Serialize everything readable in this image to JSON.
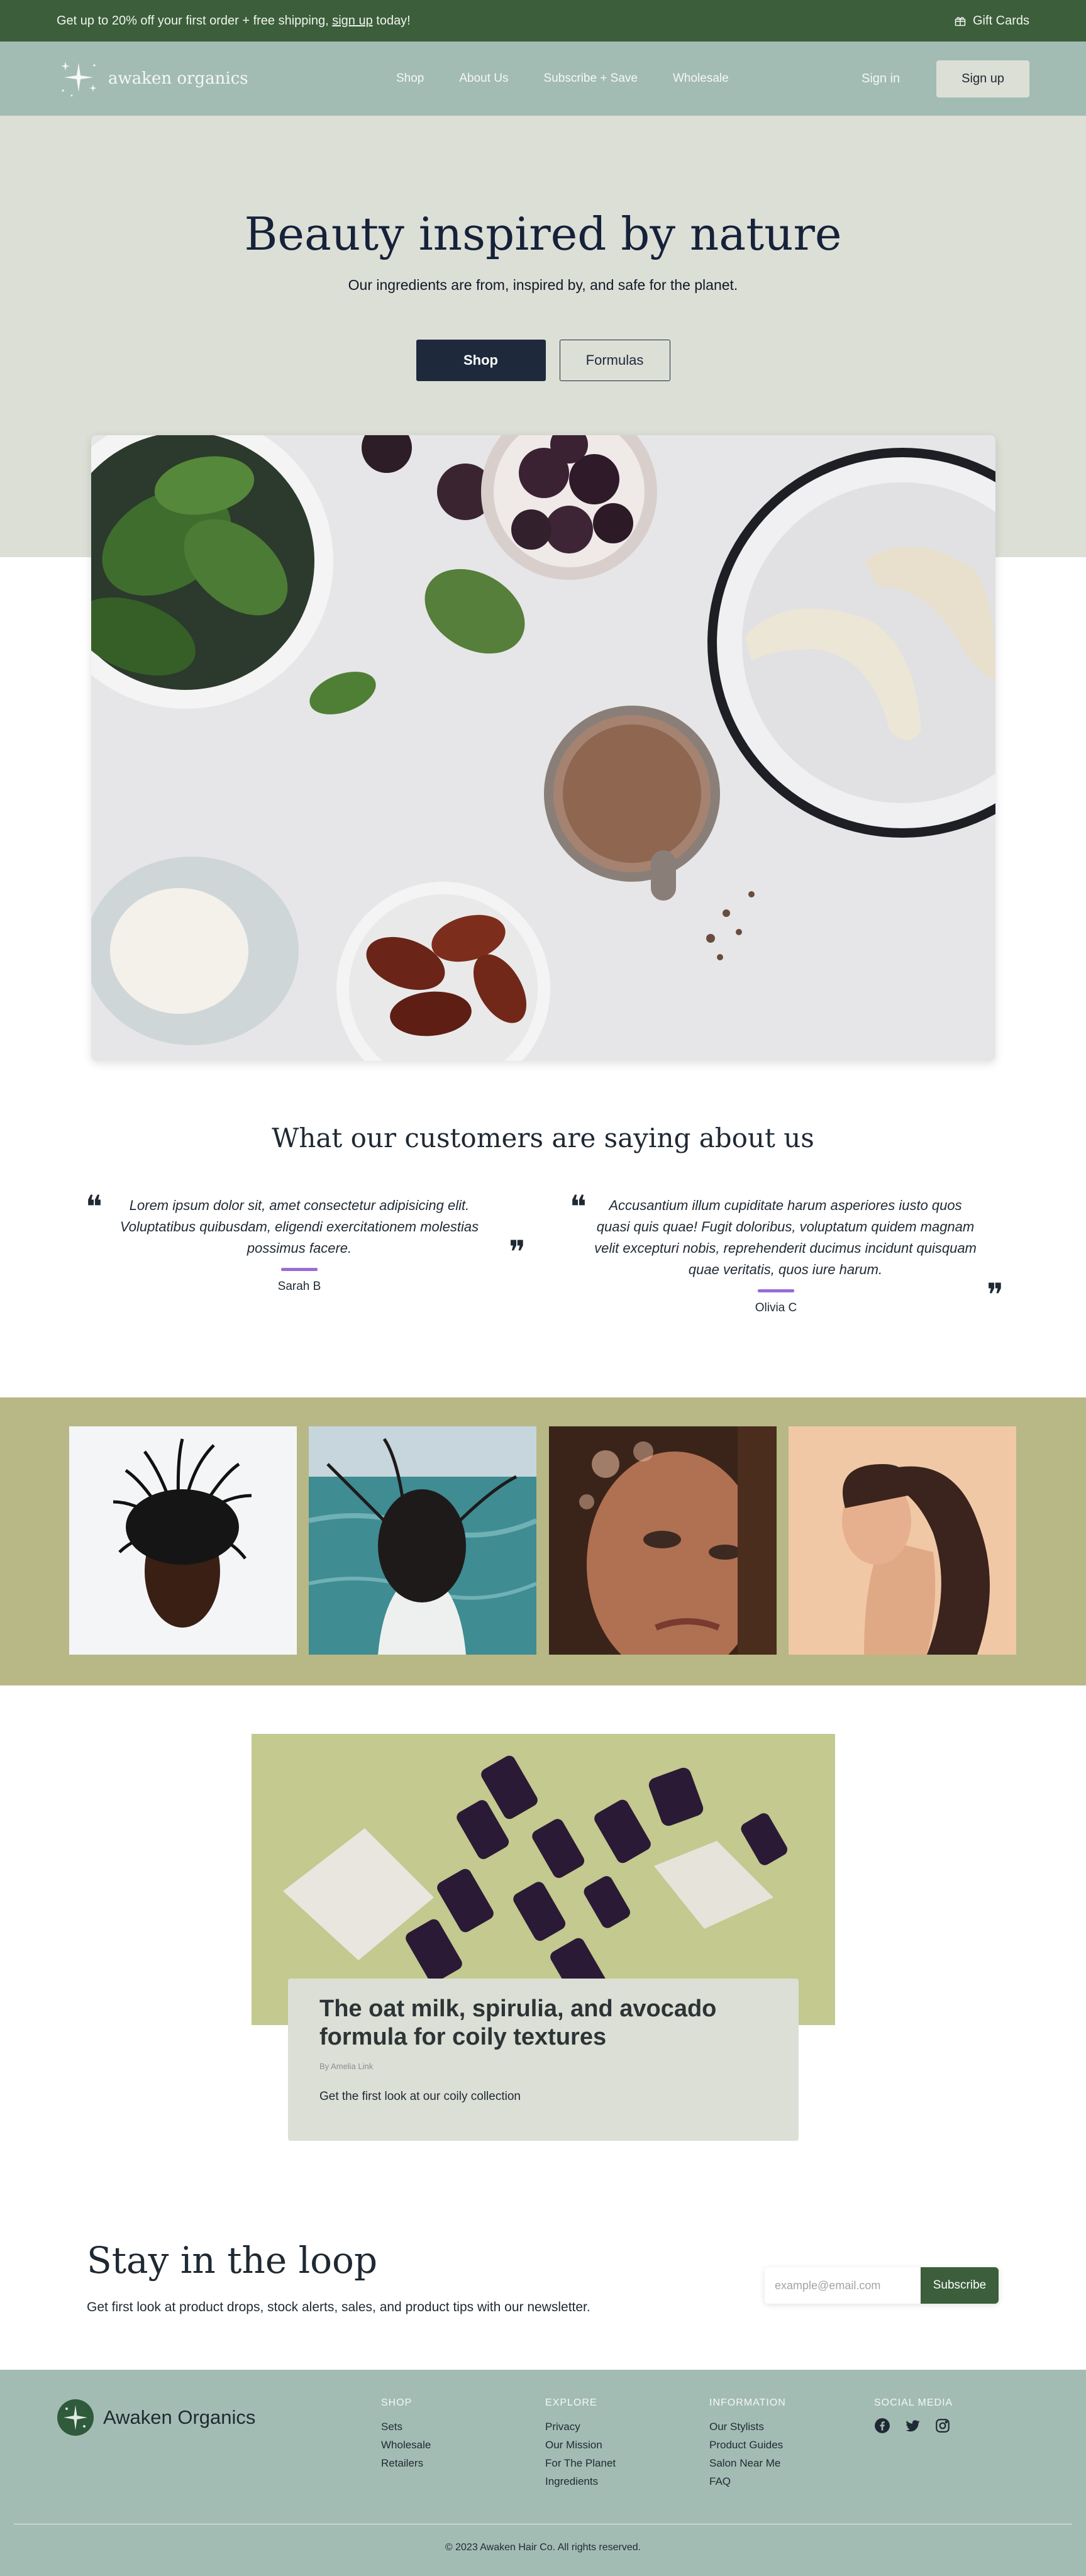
{
  "announcement": {
    "text_before": "Get up to 20% off your first order + free shipping, ",
    "link": "sign up",
    "text_after": " today!",
    "gift_cards": "Gift Cards"
  },
  "nav": {
    "logo_text": "awaken organics",
    "items": [
      "Shop",
      "About Us",
      "Subscribe + Save",
      "Wholesale"
    ],
    "sign_in": "Sign in",
    "sign_up": "Sign up"
  },
  "hero": {
    "title": "Beauty inspired by nature",
    "subtitle": "Our ingredients are from, inspired by, and safe for the planet.",
    "primary_button": "Shop",
    "secondary_button": "Formulas"
  },
  "testimonials": {
    "title": "What our customers are saying about us",
    "items": [
      {
        "quote": "Lorem ipsum dolor sit, amet consectetur adipisicing elit. Voluptatibus quibusdam, eligendi exercitationem molestias possimus facere.",
        "author": "Sarah B"
      },
      {
        "quote": "Accusantium illum cupiditate harum asperiores iusto quos quasi quis quae! Fugit doloribus, voluptatum quidem magnam velit excepturi nobis, reprehenderit ducimus incidunt quisquam quae veritatis, quos iure harum.",
        "author": "Olivia C"
      }
    ]
  },
  "feature": {
    "title": "The oat milk, spirulia, and avocado formula for coily textures",
    "byline": "By Amelia Link",
    "description": "Get the first look at our coily collection"
  },
  "newsletter": {
    "title": "Stay in the loop",
    "subtitle": "Get first look at product drops, stock alerts, sales, and product tips with our newsletter.",
    "placeholder": "example@email.com",
    "button": "Subscribe"
  },
  "footer": {
    "brand": "Awaken Organics",
    "columns": [
      {
        "heading": "SHOP",
        "links": [
          "Sets",
          "Wholesale",
          "Retailers"
        ]
      },
      {
        "heading": "EXPLORE",
        "links": [
          "Privacy",
          "Our Mission",
          "For The Planet",
          "Ingredients"
        ]
      },
      {
        "heading": "INFORMATION",
        "links": [
          "Our Stylists",
          "Product Guides",
          "Salon Near Me",
          "FAQ"
        ]
      }
    ],
    "social_heading": "SOCIAL MEDIA",
    "social_icons": [
      "facebook-icon",
      "twitter-icon",
      "instagram-icon"
    ],
    "copyright": "© 2023 Awaken Hair Co. All rights reserved."
  },
  "colors": {
    "announcement_bg": "#3c5e3b",
    "nav_bg": "#a3bcb3",
    "hero_bg": "#dcdfd6",
    "primary_button": "#1e293b",
    "gallery_bg": "#b7b886",
    "accent_bar": "#9b6bd6"
  }
}
